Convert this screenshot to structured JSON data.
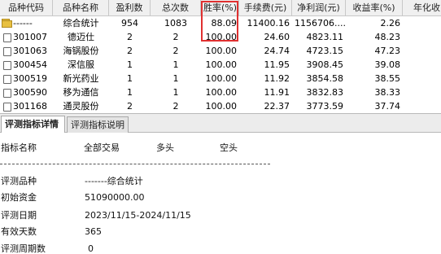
{
  "table": {
    "headers": [
      "品种代码",
      "品种名称",
      "盈利数",
      "总次数",
      "胜率(%)",
      "手续费(元)",
      "净利润(元)",
      "收益率(%)",
      "年化收"
    ],
    "summary_row": {
      "icon": "folder-icon",
      "code": "------",
      "name": "综合统计",
      "wins": "954",
      "total": "1083",
      "win_rate": "88.09",
      "fee": "11400.16",
      "net_profit": "1156706....",
      "return_rate": "2.26",
      "annual": ""
    },
    "rows": [
      {
        "code": "301007",
        "name": "德迈仕",
        "wins": "2",
        "total": "2",
        "win_rate": "100.00",
        "fee": "24.60",
        "net_profit": "4823.11",
        "return_rate": "48.23"
      },
      {
        "code": "301063",
        "name": "海锅股份",
        "wins": "2",
        "total": "2",
        "win_rate": "100.00",
        "fee": "24.74",
        "net_profit": "4723.15",
        "return_rate": "47.23"
      },
      {
        "code": "300454",
        "name": "深信服",
        "wins": "1",
        "total": "1",
        "win_rate": "100.00",
        "fee": "11.95",
        "net_profit": "3908.45",
        "return_rate": "39.08"
      },
      {
        "code": "300519",
        "name": "新光药业",
        "wins": "1",
        "total": "1",
        "win_rate": "100.00",
        "fee": "11.92",
        "net_profit": "3854.58",
        "return_rate": "38.55"
      },
      {
        "code": "300590",
        "name": "移为通信",
        "wins": "1",
        "total": "1",
        "win_rate": "100.00",
        "fee": "11.91",
        "net_profit": "3832.83",
        "return_rate": "38.33"
      },
      {
        "code": "301168",
        "name": "通灵股份",
        "wins": "2",
        "total": "2",
        "win_rate": "100.00",
        "fee": "22.37",
        "net_profit": "3773.59",
        "return_rate": "37.74"
      }
    ]
  },
  "tabs": [
    {
      "label": "评测指标详情",
      "active": true
    },
    {
      "label": "评测指标说明",
      "active": false
    }
  ],
  "detail": {
    "col_headers": [
      "指标名称",
      "全部交易",
      "多头",
      "空头"
    ],
    "fields": [
      {
        "label": "评测品种",
        "value": "-------综合统计"
      },
      {
        "label": "初始资金",
        "value": "51090000.00"
      },
      {
        "label": "评测日期",
        "value": "2023/11/15-2024/11/15"
      },
      {
        "label": "有效天数",
        "value": "365"
      },
      {
        "label": "评测周期数",
        "value": "0"
      }
    ]
  },
  "colors": {
    "highlight": "#e03030",
    "header_bg": "#f0f0f0"
  }
}
